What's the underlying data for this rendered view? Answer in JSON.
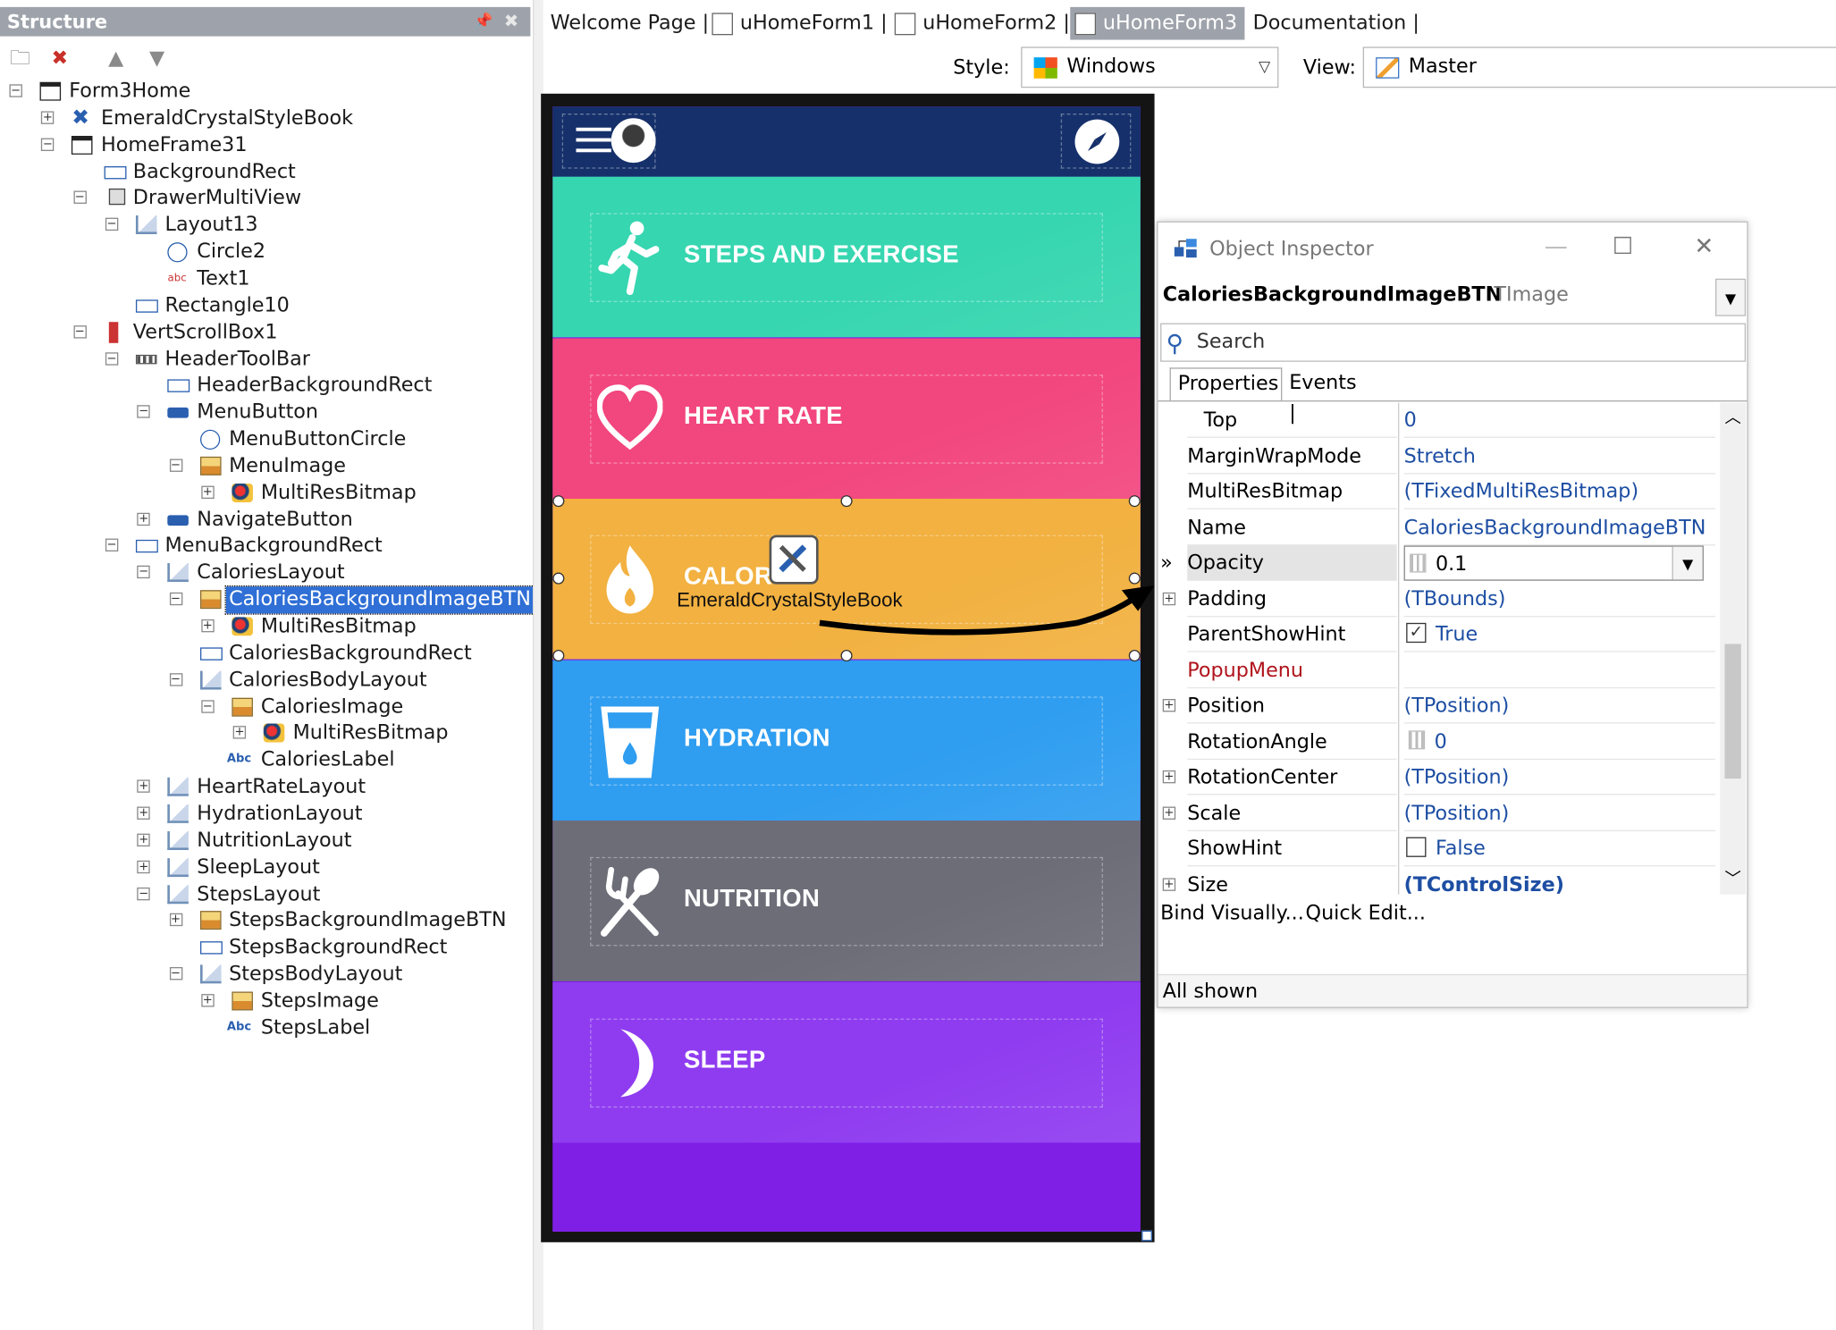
{
  "structure": {
    "title": "Structure",
    "tree": [
      {
        "label": "Form3Home",
        "icon": "form-icon"
      },
      {
        "label": "EmeraldCrystalStyleBook",
        "icon": "stylebook-icon"
      },
      {
        "label": "HomeFrame31",
        "icon": "frame-icon"
      },
      {
        "label": "BackgroundRect",
        "icon": "rectangle-icon"
      },
      {
        "label": "DrawerMultiView",
        "icon": "multiview-icon"
      },
      {
        "label": "Layout13",
        "icon": "layout-icon"
      },
      {
        "label": "Circle2",
        "icon": "circle-icon"
      },
      {
        "label": "Text1",
        "icon": "text-icon"
      },
      {
        "label": "Rectangle10",
        "icon": "rectangle-icon"
      },
      {
        "label": "VertScrollBox1",
        "icon": "scrollbox-icon"
      },
      {
        "label": "HeaderToolBar",
        "icon": "toolbar-icon"
      },
      {
        "label": "HeaderBackgroundRect",
        "icon": "rectangle-icon"
      },
      {
        "label": "MenuButton",
        "icon": "button-icon"
      },
      {
        "label": "MenuButtonCircle",
        "icon": "circle-icon"
      },
      {
        "label": "MenuImage",
        "icon": "image-icon"
      },
      {
        "label": "MultiResBitmap",
        "icon": "bitmap-icon"
      },
      {
        "label": "NavigateButton",
        "icon": "button-icon"
      },
      {
        "label": "MenuBackgroundRect",
        "icon": "rectangle-icon"
      },
      {
        "label": "CaloriesLayout",
        "icon": "layout-icon"
      },
      {
        "label": "CaloriesBackgroundImageBTN",
        "icon": "image-icon"
      },
      {
        "label": "MultiResBitmap",
        "icon": "bitmap-icon"
      },
      {
        "label": "CaloriesBackgroundRect",
        "icon": "rectangle-icon"
      },
      {
        "label": "CaloriesBodyLayout",
        "icon": "layout-icon"
      },
      {
        "label": "CaloriesImage",
        "icon": "image-icon"
      },
      {
        "label": "MultiResBitmap",
        "icon": "bitmap-icon"
      },
      {
        "label": "CaloriesLabel",
        "icon": "label-icon"
      },
      {
        "label": "HeartRateLayout",
        "icon": "layout-icon"
      },
      {
        "label": "HydrationLayout",
        "icon": "layout-icon"
      },
      {
        "label": "NutritionLayout",
        "icon": "layout-icon"
      },
      {
        "label": "SleepLayout",
        "icon": "layout-icon"
      },
      {
        "label": "StepsLayout",
        "icon": "layout-icon"
      },
      {
        "label": "StepsBackgroundImageBTN",
        "icon": "image-icon"
      },
      {
        "label": "StepsBackgroundRect",
        "icon": "rectangle-icon"
      },
      {
        "label": "StepsBodyLayout",
        "icon": "layout-icon"
      },
      {
        "label": "StepsImage",
        "icon": "image-icon"
      },
      {
        "label": "StepsLabel",
        "icon": "label-icon"
      }
    ]
  },
  "tabs": [
    "Welcome Page",
    "uHomeForm1",
    "uHomeForm2",
    "uHomeForm3",
    "Documentation"
  ],
  "active_tab": "uHomeForm3",
  "designer_toolbar": {
    "style_label": "Style:",
    "style_value": "Windows",
    "view_label": "View:",
    "view_value": "Master"
  },
  "app": {
    "tiles": [
      {
        "label": "STEPS AND EXERCISE",
        "icon": "running-person-icon",
        "color": "#36d6b0"
      },
      {
        "label": "HEART RATE",
        "icon": "heart-icon",
        "color": "#f2467e"
      },
      {
        "label": "CALORIES",
        "icon": "flame-icon",
        "color": "#f2b140"
      },
      {
        "label": "HYDRATION",
        "icon": "water-glass-icon",
        "color": "#2f9df0"
      },
      {
        "label": "NUTRITION",
        "icon": "fork-spoon-icon",
        "color": "#6d6d78"
      },
      {
        "label": "SLEEP",
        "icon": "moon-icon",
        "color": "#8f3cf0"
      }
    ],
    "calories_partial": "CALORIES",
    "drag_tooltip": "EmeraldCrystalStyleBook",
    "header_color": "#15306a"
  },
  "inspector": {
    "title": "Object Inspector",
    "selected_name": "CaloriesBackgroundImageBTN",
    "selected_type": "TImage",
    "search_placeholder": "Search",
    "tab_properties": "Properties",
    "tab_events": "Events",
    "properties": [
      {
        "name": "Top",
        "value": "0"
      },
      {
        "name": "MarginWrapMode",
        "value": "Stretch"
      },
      {
        "name": "MultiResBitmap",
        "value": "(TFixedMultiResBitmap)"
      },
      {
        "name": "Name",
        "value": "CaloriesBackgroundImageBTN"
      },
      {
        "name": "Opacity",
        "value": "0.1"
      },
      {
        "name": "Padding",
        "value": "(TBounds)"
      },
      {
        "name": "ParentShowHint",
        "value": "True"
      },
      {
        "name": "PopupMenu",
        "value": ""
      },
      {
        "name": "Position",
        "value": "(TPosition)"
      },
      {
        "name": "RotationAngle",
        "value": "0"
      },
      {
        "name": "RotationCenter",
        "value": "(TPosition)"
      },
      {
        "name": "Scale",
        "value": "(TPosition)"
      },
      {
        "name": "ShowHint",
        "value": "False"
      },
      {
        "name": "Size",
        "value": "(TControlSize)"
      }
    ],
    "bind_visually": "Bind Visually...",
    "quick_edit": "Quick Edit...",
    "status": "All shown"
  }
}
